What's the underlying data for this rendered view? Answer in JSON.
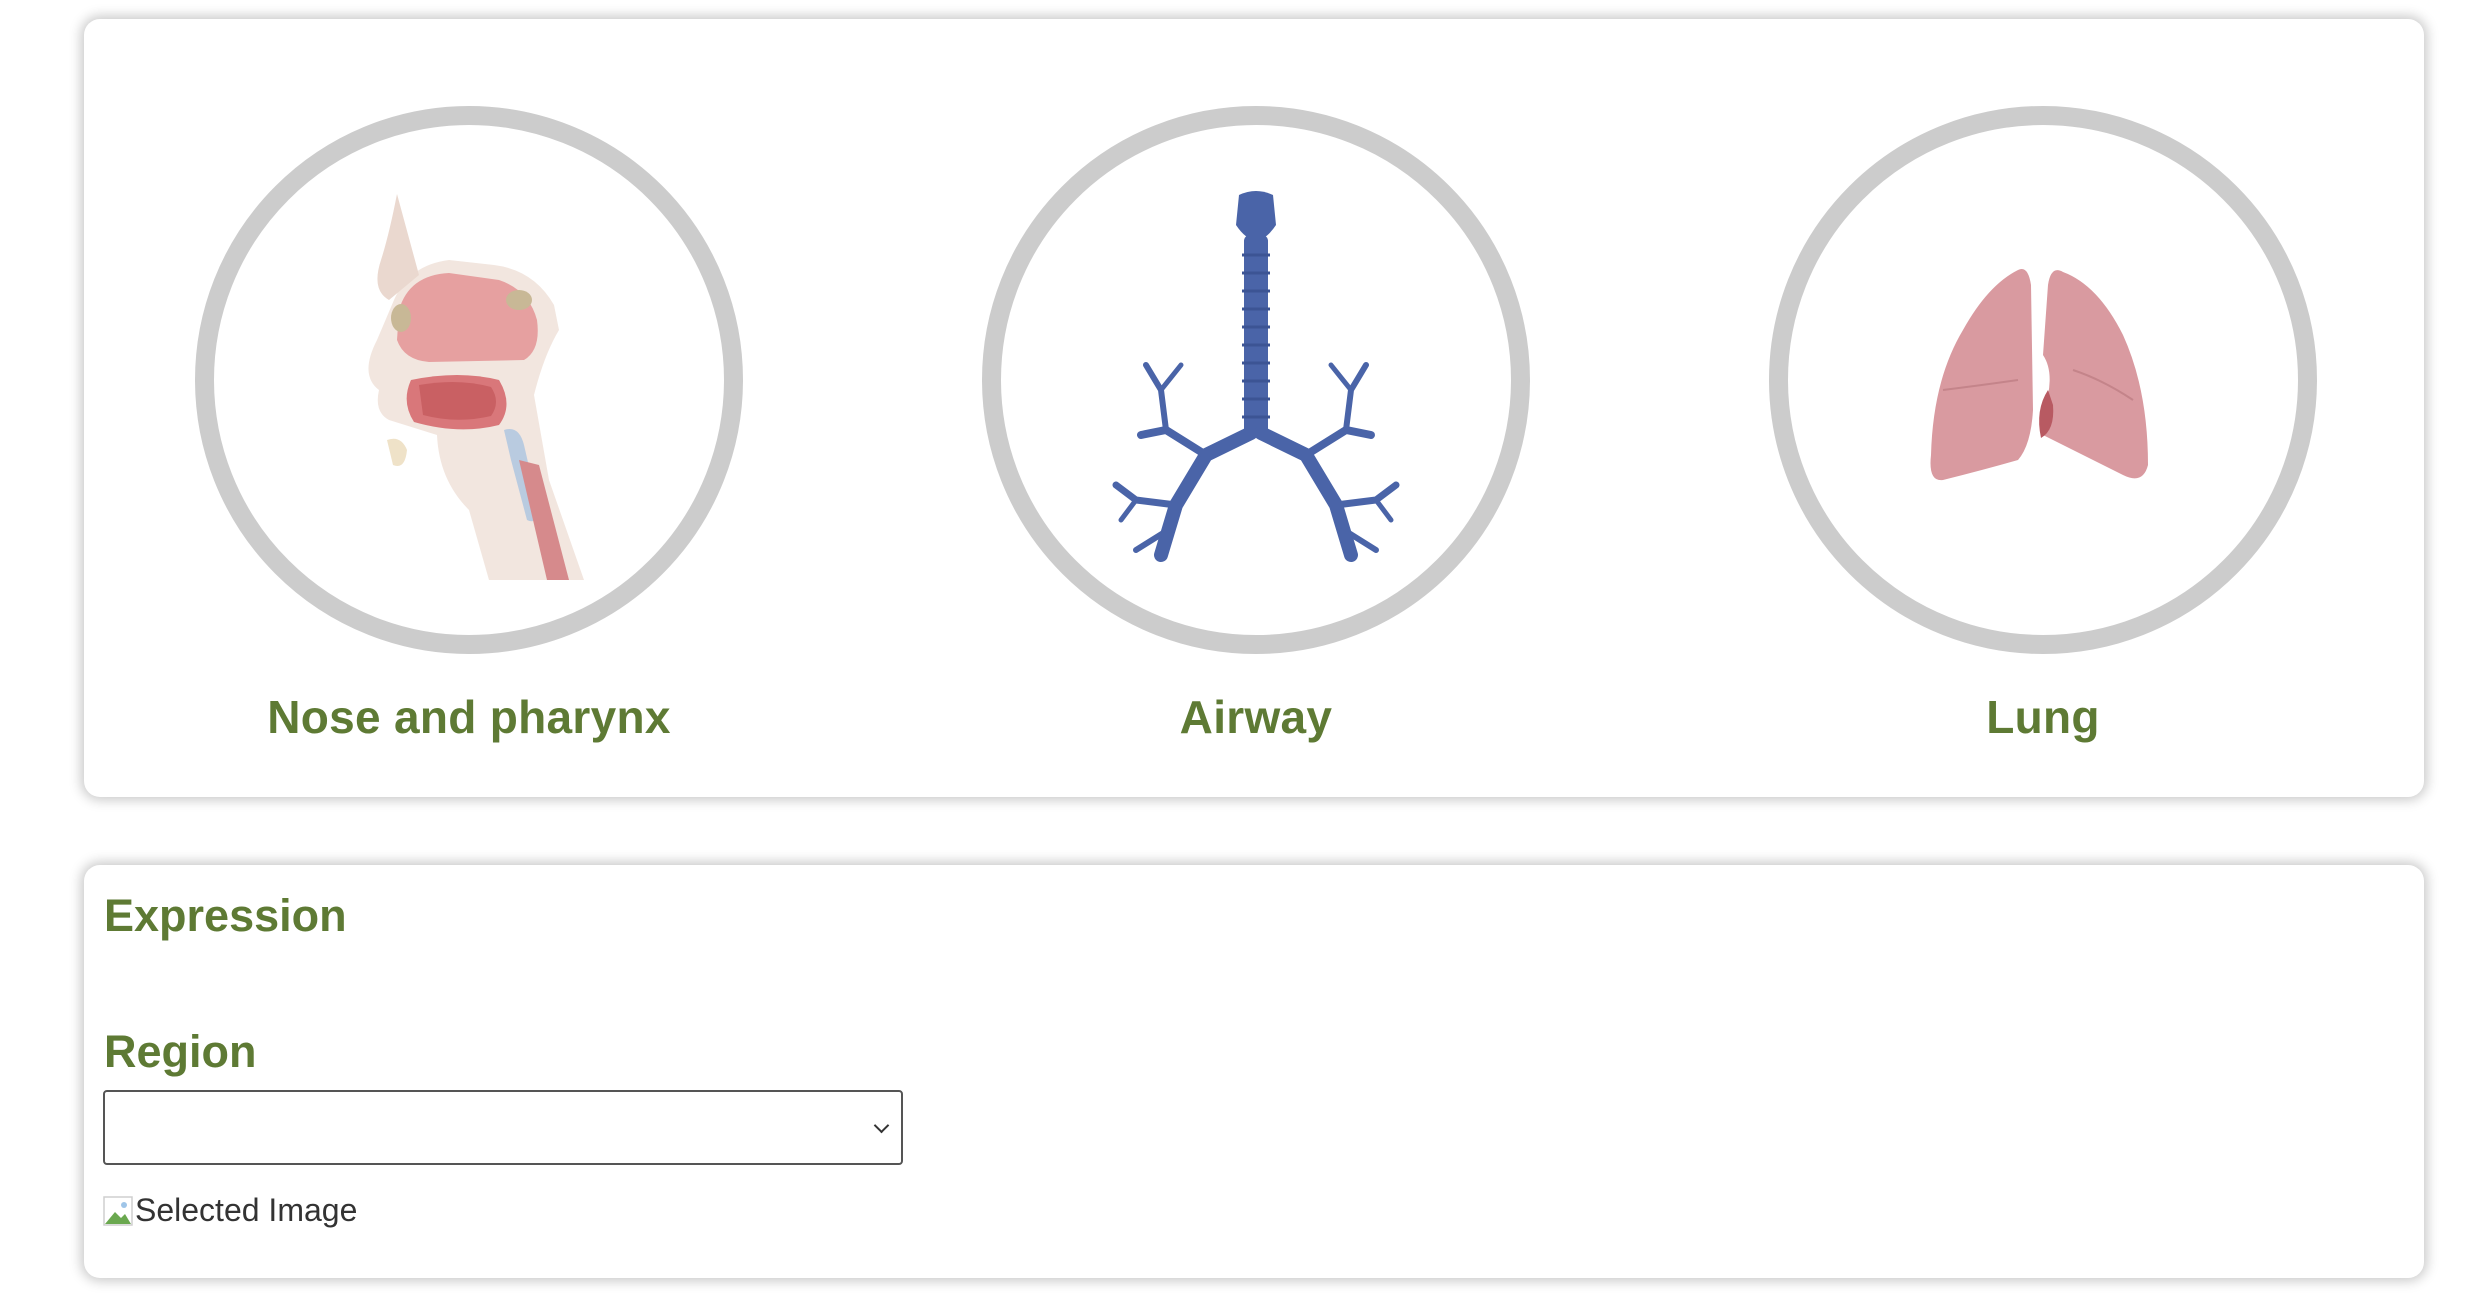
{
  "organs": {
    "items": [
      {
        "label": "Nose and pharynx",
        "icon": "nose-pharynx-anatomy-icon"
      },
      {
        "label": "Airway",
        "icon": "airway-bronchial-tree-icon"
      },
      {
        "label": "Lung",
        "icon": "lungs-icon"
      }
    ]
  },
  "expression": {
    "title": "Expression",
    "region_label": "Region",
    "region_value": "",
    "selected_image_alt": "Selected Image"
  },
  "colors": {
    "accent_green": "#5e7a34",
    "ring_gray": "#cccccc",
    "airway_blue": "#4a64a8",
    "lung_pink": "#d99aa0"
  }
}
